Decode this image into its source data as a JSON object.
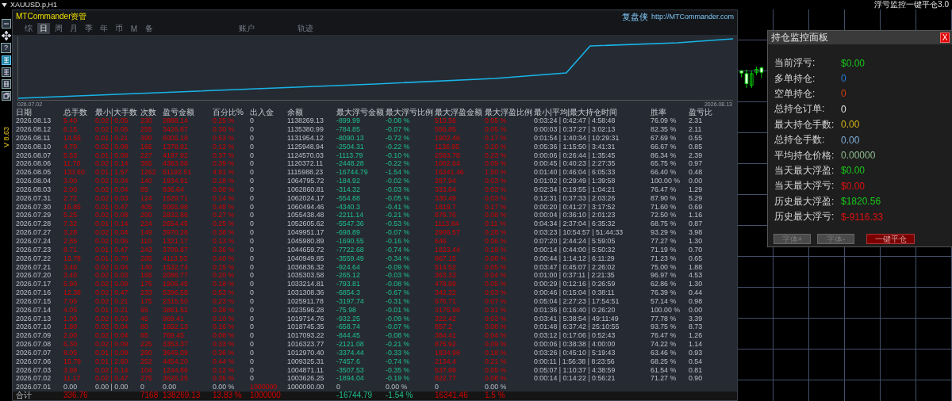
{
  "top_bar": {
    "symbol": "XAUUSD.p,H1",
    "indicator": "浮亏监控一键平仓3.0"
  },
  "side_toolbar": {
    "help": "?",
    "version": "V 8.63"
  },
  "app": {
    "brand": "MTCommander资管",
    "site_name": "复盘侠",
    "url": "http://MTCommander.com"
  },
  "tabs": [
    {
      "label": "综",
      "kind": "period",
      "selected": false
    },
    {
      "label": "日",
      "kind": "period",
      "selected": true
    },
    {
      "label": "周",
      "kind": "period",
      "selected": false
    },
    {
      "label": "月",
      "kind": "period",
      "selected": false
    },
    {
      "label": "季",
      "kind": "period",
      "selected": false
    },
    {
      "label": "年",
      "kind": "period",
      "selected": false
    },
    {
      "label": "币",
      "kind": "period",
      "selected": false
    },
    {
      "label": "M",
      "kind": "period",
      "selected": false
    },
    {
      "label": "备",
      "kind": "period",
      "selected": false
    },
    {
      "label": "账户",
      "kind": "section",
      "selected": false
    },
    {
      "label": "轨迹",
      "kind": "section",
      "selected": false
    }
  ],
  "equity_chart": {
    "x_start": "026.07.02",
    "x_end": "2026.08.13"
  },
  "table": {
    "columns": [
      "日期",
      "总手数",
      "最小|大手数",
      "次数",
      "盈亏金额",
      "百分比%",
      "出入金",
      "余额",
      "最大浮亏金额",
      "最大浮亏比例",
      "最大浮盈金额",
      "最大浮盈比例",
      "最小|平均|最大持仓时间",
      "胜率",
      "盈亏比"
    ],
    "rows": [
      {
        "kind": "day",
        "cells": [
          "2026.08.13",
          "5.40",
          "0.02 | 0.05",
          "230",
          "2888.14",
          "0.25 %",
          "0",
          "1138269.13",
          "-899.99",
          "-0.08 %",
          "510.56",
          "0.05 %",
          "0:03:24 | 0:42:47 | 4:58:48",
          "76.09 %",
          "2.31"
        ]
      },
      {
        "kind": "day",
        "cells": [
          "2026.08.12",
          "6.15",
          "0.02 | 0.05",
          "255",
          "3426.87",
          "0.30 %",
          "0",
          "1135380.99",
          "-784.85",
          "-0.07 %",
          "556.85",
          "0.05 %",
          "0:00:03 | 0:37:27 | 3:02:13",
          "82.35 %",
          "2.11"
        ]
      },
      {
        "kind": "day",
        "cells": [
          "2026.08.11",
          "14.55",
          "0.01 | 0.21",
          "390",
          "6005.18",
          "0.53 %",
          "0",
          "1131954.12",
          "-8090.13",
          "-0.72 %",
          "1902.46",
          "0.17 %",
          "0:01:54 | 1:40:34 | 10:29:31",
          "67.69 %",
          "0.55"
        ]
      },
      {
        "kind": "day",
        "cells": [
          "2026.08.10",
          "4.70",
          "0.02 | 0.08",
          "165",
          "1378.91",
          "0.12 %",
          "0",
          "1125948.94",
          "-2504.31",
          "-0.22 %",
          "1136.95",
          "0.10 %",
          "0:05:36 | 1:15:50 | 3:41:31",
          "66.67 %",
          "0.85"
        ]
      },
      {
        "kind": "day",
        "cells": [
          "2026.08.07",
          "5.53",
          "0.01 | 0.08",
          "227",
          "4197.92",
          "0.37 %",
          "0",
          "1124570.03",
          "-1113.79",
          "-0.10 %",
          "2563.78",
          "0.23 %",
          "0:00:06 | 0:26:44 | 1:35:45",
          "86.34 %",
          "2.39"
        ]
      },
      {
        "kind": "day",
        "cells": [
          "2026.08.06",
          "11.70",
          "0.02 | 0.14",
          "365",
          "4383.88",
          "0.39 %",
          "0",
          "1120372.11",
          "-2448.28",
          "-0.22 %",
          "1002.64",
          "0.09 %",
          "0:00:45 | 0:40:23 | 2:27:35",
          "65.75 %",
          "0.97"
        ]
      },
      {
        "kind": "day",
        "cells": [
          "2026.08.05",
          "133.60",
          "0.01 | 1.57",
          "1262",
          "51192.51",
          "4.81 %",
          "0",
          "1115988.23",
          "-16744.79",
          "-1.54 %",
          "16341.46",
          "1.50 %",
          "0:01:40 | 0:46:04 | 6:05:33",
          "66.40 %",
          "0.48"
        ]
      },
      {
        "kind": "day",
        "cells": [
          "2026.08.04",
          "3.00",
          "0.02 | 0.04",
          "140",
          "1934.91",
          "0.18 %",
          "0",
          "1064795.72",
          "-184.92",
          "-0.02 %",
          "287.94",
          "0.03 %",
          "0:01:02 | 0:29:49 | 1:39:58",
          "100.00 %",
          "0.00"
        ]
      },
      {
        "kind": "day",
        "cells": [
          "2026.08.03",
          "2.00",
          "0.02 | 0.04",
          "85",
          "836.64",
          "0.08 %",
          "0",
          "1062860.81",
          "-314.32",
          "-0.03 %",
          "333.84",
          "0.03 %",
          "0:02:34 | 0:19:55 | 1:04:21",
          "76.47 %",
          "1.29"
        ]
      },
      {
        "kind": "day",
        "cells": [
          "2026.07.31",
          "2.72",
          "0.02 | 0.03",
          "124",
          "1529.71",
          "0.14 %",
          "0",
          "1062024.17",
          "-554.88",
          "-0.05 %",
          "330.49",
          "0.03 %",
          "0:12:31 | 0:37:33 | 2:03:26",
          "87.90 %",
          "5.29"
        ]
      },
      {
        "kind": "day",
        "cells": [
          "2026.07.30",
          "16.85",
          "0.01 | 0.47",
          "405",
          "5055.98",
          "0.48 %",
          "0",
          "1060494.46",
          "-4340.3",
          "-0.41 %",
          "1819.7",
          "0.17 %",
          "0:00:20 | 0:41:27 | 3:17:52",
          "71.60 %",
          "0.69"
        ]
      },
      {
        "kind": "day",
        "cells": [
          "2026.07.29",
          "5.25",
          "0.02 | 0.08",
          "200",
          "2832.86",
          "0.27 %",
          "0",
          "1055438.48",
          "-2211.14",
          "-0.21 %",
          "876.76",
          "0.08 %",
          "0:00:04 | 0:36:10 | 2:01:23",
          "72.50 %",
          "1.16"
        ]
      },
      {
        "kind": "day",
        "cells": [
          "2026.07.28",
          "7.32",
          "0.01 | 0.14",
          "224",
          "2654.45",
          "0.25 %",
          "0",
          "1052605.62",
          "-5547.36",
          "-0.53 %",
          "1113.84",
          "0.11 %",
          "0:04:34 | 2:37:04 | 6:35:32",
          "68.75 %",
          "0.87"
        ]
      },
      {
        "kind": "day",
        "cells": [
          "2026.07.27",
          "3.28",
          "0.02 | 0.04",
          "149",
          "3970.28",
          "0.38 %",
          "0",
          "1049951.17",
          "-698.89",
          "-0.07 %",
          "2906.57",
          "0.28 %",
          "0:03:23 | 10:54:57 | 51:44:33",
          "93.29 %",
          "3.98"
        ]
      },
      {
        "kind": "day",
        "cells": [
          "2026.07.24",
          "2.85",
          "0.02 | 0.06",
          "110",
          "1321.17",
          "0.13 %",
          "0",
          "1045980.89",
          "-1690.55",
          "-0.16 %",
          "646",
          "0.06 %",
          "0:07:20 | 2:44:24 | 5:59:05",
          "77.27 %",
          "1.30"
        ]
      },
      {
        "kind": "day",
        "cells": [
          "2026.07.23",
          "8.71",
          "0.01 | 0.47",
          "243",
          "3709.87",
          "0.36 %",
          "0",
          "1044659.72",
          "-7722.68",
          "-0.74 %",
          "1823.44",
          "0.18 %",
          "0:00:14 | 0:44:00 | 5:50:32",
          "71.19 %",
          "0.70"
        ]
      },
      {
        "kind": "day",
        "cells": [
          "2026.07.22",
          "16.78",
          "0.01 | 0.70",
          "285",
          "4113.53",
          "0.40 %",
          "0",
          "1040949.85",
          "-3559.49",
          "-0.34 %",
          "867.15",
          "0.08 %",
          "0:00:44 | 1:14:12 | 6:11:29",
          "71.23 %",
          "0.65"
        ]
      },
      {
        "kind": "day",
        "cells": [
          "2026.07.21",
          "3.40",
          "0.02 | 0.04",
          "140",
          "1532.74",
          "0.15 %",
          "0",
          "1036836.32",
          "-924.64",
          "-0.09 %",
          "514.52",
          "0.05 %",
          "0:03:47 | 0:45:07 | 2:26:02",
          "75.00 %",
          "1.88"
        ]
      },
      {
        "kind": "day",
        "cells": [
          "2026.07.20",
          "3.40",
          "0.02 | 0.03",
          "165",
          "2088.77",
          "0.20 %",
          "0",
          "1035303.58",
          "-265.12",
          "-0.03 %",
          "363.33",
          "0.04 %",
          "0:01:00 | 0:37:11 | 2:21:35",
          "96.97 %",
          "4.53"
        ]
      },
      {
        "kind": "day",
        "cells": [
          "2026.07.17",
          "5.90",
          "0.02 | 0.09",
          "175",
          "1906.45",
          "0.18 %",
          "0",
          "1033214.81",
          "-793.81",
          "-0.08 %",
          "478.89",
          "0.05 %",
          "0:00:29 | 0:12:16 | 0:26:59",
          "62.86 %",
          "1.30"
        ]
      },
      {
        "kind": "day",
        "cells": [
          "2026.07.16",
          "12.38",
          "0.02 | 0.47",
          "233",
          "5396.58",
          "0.53 %",
          "0",
          "1031308.36",
          "-6854.3",
          "-0.67 %",
          "342.32",
          "0.03 %",
          "0:00:46 | 0:15:04 | 0:38:11",
          "76.39 %",
          "0.44"
        ]
      },
      {
        "kind": "day",
        "cells": [
          "2026.07.15",
          "7.05",
          "0.02 | 0.21",
          "175",
          "2315.50",
          "0.23 %",
          "0",
          "1025911.78",
          "-3197.74",
          "-0.31 %",
          "676.71",
          "0.07 %",
          "0:05:04 | 2:27:23 | 17:54:51",
          "57.14 %",
          "0.98"
        ]
      },
      {
        "kind": "day",
        "cells": [
          "2026.07.14",
          "4.05",
          "0.01 | 0.21",
          "95",
          "3881.52",
          "0.38 %",
          "0",
          "1023596.28",
          "-75.98",
          "-0.01 %",
          "3175.96",
          "0.31 %",
          "0:01:36 | 0:16:40 | 0:26:20",
          "100.00 %",
          "0.00"
        ]
      },
      {
        "kind": "day",
        "cells": [
          "2026.07.13",
          "1.00",
          "0.02 | 0.03",
          "45",
          "969.41",
          "0.10 %",
          "0",
          "1019714.76",
          "-932.25",
          "-0.09 %",
          "322.42",
          "0.03 %",
          "0:03:41 | 5:38:54 | 49:11:49",
          "77.78 %",
          "3.39"
        ]
      },
      {
        "kind": "day",
        "cells": [
          "2026.07.10",
          "1.90",
          "0.02 | 0.04",
          "80",
          "1652.13",
          "0.16 %",
          "0",
          "1018745.35",
          "-658.74",
          "-0.07 %",
          "857.2",
          "0.08 %",
          "0:01:48 | 6:37:42 | 25:10:55",
          "93.75 %",
          "8.73"
        ]
      },
      {
        "kind": "day",
        "cells": [
          "2026.07.09",
          "2.00",
          "0.02 | 0.04",
          "85",
          "769.45",
          "0.08 %",
          "0",
          "1017093.22",
          "-844.45",
          "-0.08 %",
          "384.41",
          "0.04 %",
          "0:03:12 | 0:17:06 | 0:52:43",
          "76.47 %",
          "1.26"
        ]
      },
      {
        "kind": "day",
        "cells": [
          "2026.07.08",
          "6.30",
          "0.02 | 0.09",
          "225",
          "3353.37",
          "0.33 %",
          "0",
          "1016323.77",
          "-2121.08",
          "-0.21 %",
          "875.92",
          "0.09 %",
          "0:00:06 | 0:38:38 | 4:00:00",
          "74.22 %",
          "1.14"
        ]
      },
      {
        "kind": "day",
        "cells": [
          "2026.07.07",
          "8.05",
          "0.01 | 0.09",
          "260",
          "3645.09",
          "0.36 %",
          "0",
          "1012970.40",
          "-3374.44",
          "-0.33 %",
          "1834.96",
          "0.18 %",
          "0:03:26 | 0:45:10 | 5:19:43",
          "63.46 %",
          "0.93"
        ]
      },
      {
        "kind": "day",
        "cells": [
          "2026.07.06",
          "15.79",
          "0.01 | 2.60",
          "252",
          "4454.20",
          "0.44 %",
          "0",
          "1009325.31",
          "-7457.6",
          "-0.74 %",
          "2134.4",
          "0.21 %",
          "0:00:11 | 1:56:38 | 8:23:56",
          "68.25 %",
          "0.54"
        ]
      },
      {
        "kind": "day",
        "cells": [
          "2026.07.03",
          "3.98",
          "0.02 | 0.14",
          "104",
          "1244.86",
          "0.12 %",
          "0",
          "1004871.11",
          "-3507.53",
          "-0.35 %",
          "537.98",
          "0.05 %",
          "0:05:07 | 1:10:37 | 4:38:59",
          "61.54 %",
          "0.81"
        ]
      },
      {
        "kind": "day",
        "cells": [
          "2026.07.02",
          "11.17",
          "0.02 | 0.47",
          "275",
          "3626.25",
          "0.36 %",
          "0",
          "1003626.25",
          "-1894.04",
          "-0.19 %",
          "822.77",
          "0.08 %",
          "0:00:14 | 0:14:22 | 0:56:21",
          "71.27 %",
          "0.90"
        ]
      },
      {
        "kind": "opening",
        "cells": [
          "2026.07.01",
          "0.00",
          "0.00 | 0.00",
          "0",
          "0.00",
          "0.00 %",
          "1000000",
          "1000000.00",
          "0",
          "0.00 %",
          "0",
          "0.00 %",
          null,
          null,
          null
        ]
      },
      {
        "kind": "total",
        "cells": [
          "合计",
          "336.76",
          null,
          "7168",
          "138269.13",
          "13.83 %",
          "1000000",
          null,
          "-16744.79",
          "-1.54 %",
          "16341.46",
          "1.5 %",
          null,
          null,
          null
        ]
      }
    ]
  },
  "monitor_panel": {
    "title": "持仓监控面板",
    "close": "X",
    "rows": [
      {
        "label": "当前浮亏:",
        "value": "$0.00",
        "color": "#19c819"
      },
      {
        "label": "多单持仓:",
        "value": "0",
        "color": "#2a7de0"
      },
      {
        "label": "空单持仓:",
        "value": "0",
        "color": "#d2410f"
      },
      {
        "label": "总持仓订单:",
        "value": "0",
        "color": "#e6e6e6"
      },
      {
        "label": "最大持仓手数:",
        "value": "0.00",
        "color": "#d8b414"
      },
      {
        "label": "总持仓手数:",
        "value": "0.00",
        "color": "#7fb0dc"
      },
      {
        "label": "平均持仓价格:",
        "value": "0.00000",
        "color": "#8fbc8f"
      },
      {
        "label": "当天最大浮盈:",
        "value": "$0.00",
        "color": "#19c819"
      },
      {
        "label": "当天最大浮亏:",
        "value": "$0.00",
        "color": "#e01010"
      },
      {
        "label": "历史最大浮盈:",
        "value": "$1820.56",
        "color": "#19c819"
      },
      {
        "label": "历史最大浮亏:",
        "value": "$-9116.33",
        "color": "#e01010"
      }
    ],
    "buttons": [
      {
        "label": "字体+",
        "kind": "plain"
      },
      {
        "label": "字体-",
        "kind": "plain"
      },
      {
        "label": "一键平仓",
        "kind": "danger"
      }
    ]
  }
}
